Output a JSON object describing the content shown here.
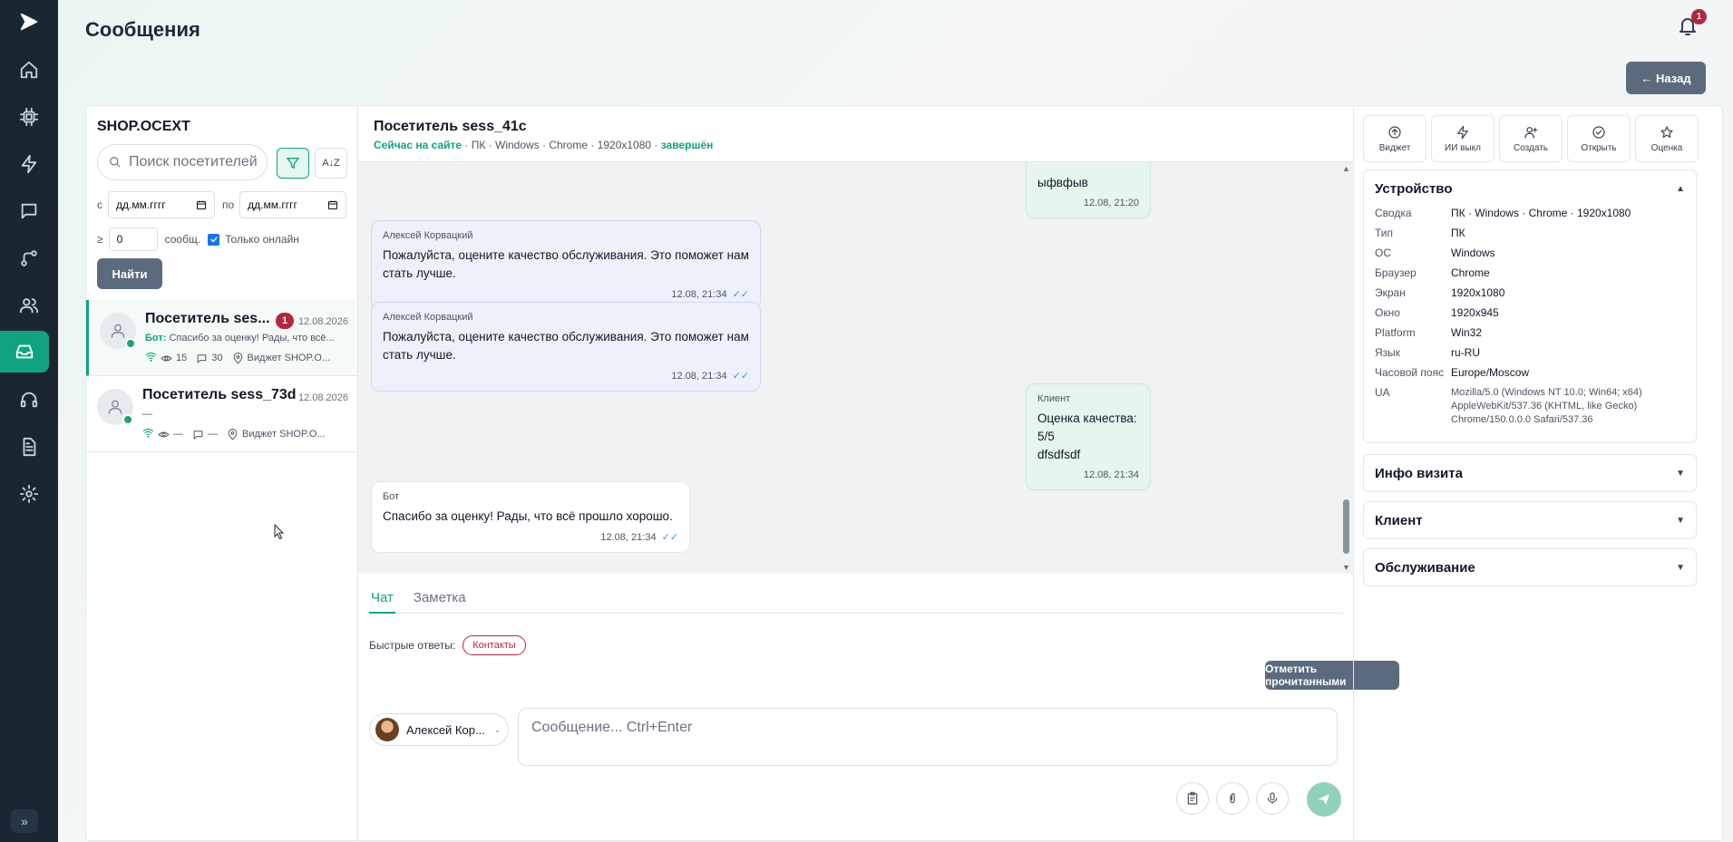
{
  "page": {
    "title": "Сообщения",
    "back_label": "← Назад",
    "notifications_count": "1"
  },
  "sidebar": {
    "icons": [
      "logo-icon",
      "home-icon",
      "cpu-icon",
      "bolt-icon",
      "chat-icon",
      "branch-icon",
      "users-icon",
      "inbox-icon",
      "headset-icon",
      "document-icon",
      "settings-icon"
    ],
    "active": "inbox-icon",
    "expand_label": "»"
  },
  "filters": {
    "shop": "SHOP.OCEXT",
    "search_placeholder": "Поиск посетителей",
    "az_label": "A↓Z",
    "from_label": "с",
    "to_label": "по",
    "date_placeholder": "дд.мм.гггг",
    "min_prefix": "≥",
    "min_value": "0",
    "min_suffix": "сообщ.",
    "online_only_label": "Только онлайн",
    "online_only_checked": true,
    "find_label": "Найти"
  },
  "conversations": [
    {
      "name": "Посетитель ses...",
      "unread": "1",
      "date": "12.08.2026",
      "preview_prefix": "Бот:",
      "preview": "Спасибо за оценку! Рады, что всё...",
      "views": "15",
      "messages": "30",
      "source": "Виджет SHOP.O...",
      "selected": true
    },
    {
      "name": "Посетитель sess_73d",
      "unread": "",
      "date": "12.08.2026",
      "preview_prefix": "",
      "preview": "—",
      "views": "—",
      "messages": "—",
      "source": "Виджет SHOP.O...",
      "selected": false
    }
  ],
  "chat": {
    "title": "Посетитель sess_41c",
    "status_online": "Сейчас на сайте",
    "status_device": " · ПК · Windows · Chrome · 1920x1080 · ",
    "status_state": "завершён",
    "messages": [
      {
        "kind": "client",
        "author": "",
        "text": "ыфвфыв",
        "time": "12.08, 21:20",
        "read": ""
      },
      {
        "kind": "operator",
        "author": "Алексей Корвацкий",
        "text": "Пожалуйста, оцените качество обслуживания. Это поможет нам стать лучше.",
        "time": "12.08, 21:34",
        "read": "✓✓"
      },
      {
        "kind": "operator",
        "author": "Алексей Корвацкий",
        "text": "Пожалуйста, оцените качество обслуживания. Это поможет нам стать лучше.",
        "time": "12.08, 21:34",
        "read": "✓✓"
      },
      {
        "kind": "client",
        "author": "Клиент",
        "text": "Оценка качества: 5/5",
        "text2": "dfsdfsdf",
        "time": "12.08, 21:34",
        "read": ""
      },
      {
        "kind": "bot",
        "author": "Бот",
        "text": "Спасибо за оценку! Рады, что всё прошло хорошо.",
        "time": "12.08, 21:34",
        "read": "✓✓"
      }
    ]
  },
  "composer": {
    "tabs": [
      "Чат",
      "Заметка"
    ],
    "active_tab": "Чат",
    "quick_label": "Быстрые ответы:",
    "quick_replies": [
      "Контакты"
    ],
    "mark_read_label": "Отметить прочитанными",
    "agent_name": "Алексей Кор...",
    "input_placeholder": "Сообщение... Ctrl+Enter"
  },
  "info": {
    "actions": [
      {
        "icon": "upload-icon",
        "label": "Виджет"
      },
      {
        "icon": "bolt-icon",
        "label": "ИИ выкл"
      },
      {
        "icon": "user-plus-icon",
        "label": "Создать"
      },
      {
        "icon": "check-circle-icon",
        "label": "Открыть"
      },
      {
        "icon": "star-icon",
        "label": "Оценка"
      }
    ],
    "device": {
      "title": "Устройство",
      "rows": [
        {
          "k": "Сводка",
          "v": "ПК · Windows · Chrome · 1920x1080"
        },
        {
          "k": "Тип",
          "v": "ПК"
        },
        {
          "k": "ОС",
          "v": "Windows"
        },
        {
          "k": "Браузер",
          "v": "Chrome"
        },
        {
          "k": "Экран",
          "v": "1920x1080"
        },
        {
          "k": "Окно",
          "v": "1920x945"
        },
        {
          "k": "Platform",
          "v": "Win32"
        },
        {
          "k": "Язык",
          "v": "ru-RU"
        },
        {
          "k": "Часовой пояс",
          "v": "Europe/Moscow"
        }
      ],
      "ua_label": "UA",
      "ua_value": "Mozilla/5.0 (Windows NT 10.0; Win64; x64) AppleWebKit/537.36 (KHTML, like Gecko) Chrome/150.0.0.0 Safari/537.36"
    },
    "sections": [
      "Инфо визита",
      "Клиент",
      "Обслуживание"
    ]
  },
  "colors": {
    "accent": "#10a37f",
    "danger": "#b3263d",
    "rail": "#1a2733",
    "button": "#5b6b7d"
  }
}
